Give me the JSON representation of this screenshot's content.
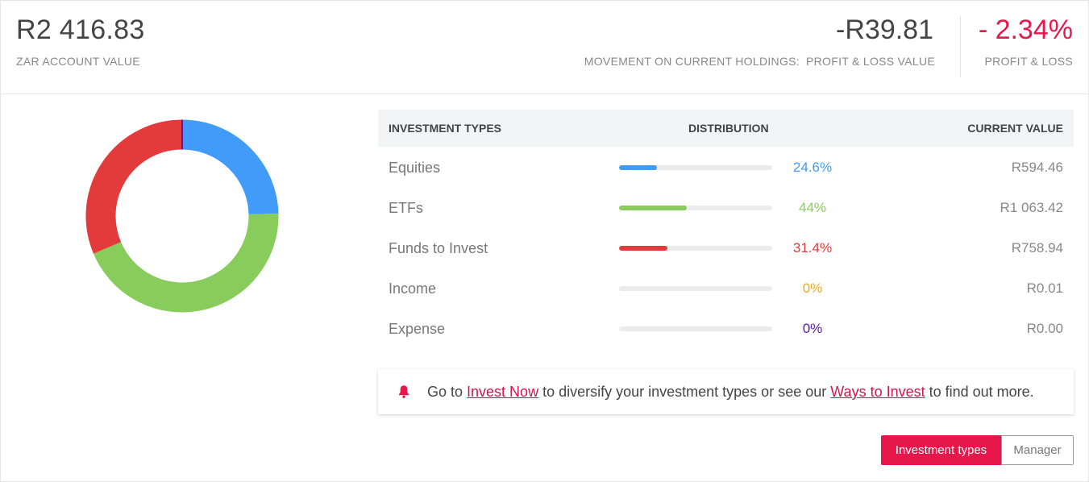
{
  "header": {
    "account_value": "R2 416.83",
    "account_label": "ZAR ACCOUNT VALUE",
    "movement_label": "MOVEMENT ON CURRENT HOLDINGS:",
    "pl_value": "-R39.81",
    "pl_label": "PROFIT & LOSS VALUE",
    "pl_percent": "- 2.34%",
    "pl_percent_label": "PROFIT & LOSS"
  },
  "table": {
    "headers": {
      "type": "INVESTMENT TYPES",
      "distribution": "DISTRIBUTION",
      "value": "CURRENT VALUE"
    },
    "rows": [
      {
        "name": "Equities",
        "percent_label": "24.6%",
        "fraction": 0.246,
        "value": "R594.46",
        "color": "#419bf9"
      },
      {
        "name": "ETFs",
        "percent_label": "44%",
        "fraction": 0.44,
        "value": "R1 063.42",
        "color": "#88cc5b"
      },
      {
        "name": "Funds to Invest",
        "percent_label": "31.4%",
        "fraction": 0.314,
        "value": "R758.94",
        "color": "#e33b3b"
      },
      {
        "name": "Income",
        "percent_label": "0%",
        "fraction": 0.0,
        "value": "R0.01",
        "color": "#f2a81d"
      },
      {
        "name": "Expense",
        "percent_label": "0%",
        "fraction": 0.0,
        "value": "R0.00",
        "color": "#5a17a6"
      }
    ]
  },
  "notice": {
    "icon": "bell-icon",
    "text_before": "Go to ",
    "link1": "Invest Now",
    "text_middle": " to diversify your investment types or see our ",
    "link2": "Ways to Invest",
    "text_after": " to find out more."
  },
  "toggle": {
    "active_label": "Investment types",
    "inactive_label": "Manager"
  },
  "chart_data": {
    "type": "pie",
    "categories": [
      "Equities",
      "ETFs",
      "Funds to Invest",
      "Income",
      "Expense"
    ],
    "values": [
      24.6,
      44,
      31.4,
      0,
      0
    ],
    "colors": [
      "#419bf9",
      "#88cc5b",
      "#e33b3b",
      "#f2a81d",
      "#5a17a6"
    ],
    "style": "donut"
  }
}
